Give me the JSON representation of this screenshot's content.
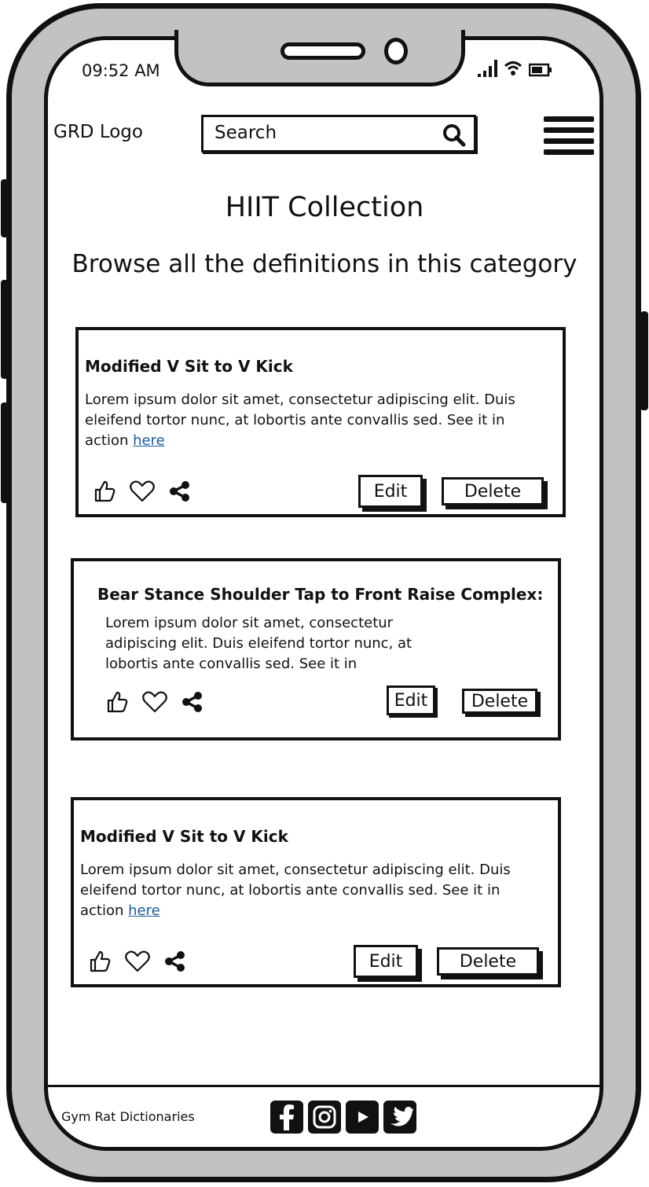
{
  "status_bar": {
    "time": "09:52 AM"
  },
  "header": {
    "logo": "GRD Logo",
    "search_placeholder": "Search"
  },
  "page": {
    "title": "HIIT Collection",
    "subtitle": "Browse all the definitions in this category"
  },
  "cards": [
    {
      "title": "Modified V Sit to V Kick",
      "body": "Lorem ipsum dolor sit amet, consectetur adipiscing elit. Duis eleifend tortor nunc, at lobortis ante convallis sed. See it in action ",
      "link": "here",
      "edit_label": "Edit",
      "delete_label": "Delete"
    },
    {
      "title": "Bear Stance Shoulder Tap to Front Raise Complex:",
      "body": "Lorem ipsum dolor sit amet, consectetur adipiscing elit. Duis eleifend tortor nunc, at lobortis ante convallis sed. See it in",
      "edit_label": "Edit",
      "delete_label": "Delete"
    },
    {
      "title": "Modified V Sit to V Kick",
      "body": "Lorem ipsum dolor sit amet, consectetur adipiscing elit. Duis eleifend tortor nunc, at lobortis ante convallis sed. See it in action ",
      "link": "here",
      "edit_label": "Edit",
      "delete_label": "Delete"
    }
  ],
  "footer": {
    "brand": "Gym Rat Dictionaries"
  },
  "colors": {
    "frame": "#c2c2c2",
    "ink": "#111111",
    "link": "#1a5c9e"
  },
  "icons": [
    "signal-icon",
    "wifi-icon",
    "battery-icon",
    "search-icon",
    "hamburger-menu-icon",
    "thumbs-up-icon",
    "heart-icon",
    "share-icon",
    "facebook-icon",
    "instagram-icon",
    "youtube-icon",
    "twitter-icon"
  ]
}
